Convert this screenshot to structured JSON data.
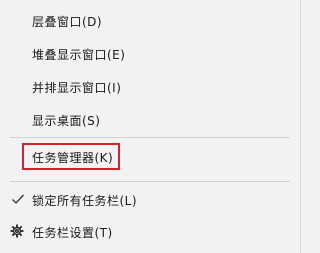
{
  "menu": {
    "items": [
      {
        "label": "层叠窗口(D)"
      },
      {
        "label": "堆叠显示窗口(E)"
      },
      {
        "label": "并排显示窗口(I)"
      },
      {
        "label": "显示桌面(S)"
      },
      {
        "label": "任务管理器(K)"
      },
      {
        "label": "锁定所有任务栏(L)",
        "icon": "checkmark-icon"
      },
      {
        "label": "任务栏设置(T)",
        "icon": "gear-icon"
      }
    ],
    "highlight_color": "#d6232a"
  }
}
